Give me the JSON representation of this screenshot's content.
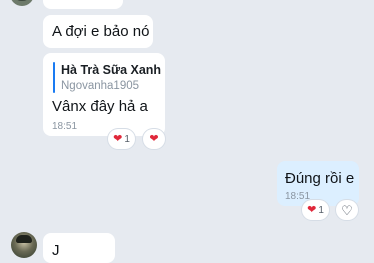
{
  "conversation": {
    "messages": [
      {
        "id": "m2",
        "text": "A đợi e bảo nó"
      },
      {
        "id": "m3",
        "quote": {
          "author": "Hà Trà Sữa Xanh",
          "text": "Ngovanha1905"
        },
        "text": "Vânx đây hả a",
        "time": "18:51",
        "reactions": {
          "heart_count": "1"
        }
      },
      {
        "id": "m4",
        "text": "Đúng rồi e",
        "time": "18:51",
        "reactions": {
          "heart_count": "1"
        }
      },
      {
        "id": "m5",
        "text": "J"
      }
    ]
  },
  "colors": {
    "background": "#e6eaf0",
    "incoming_bubble": "#ffffff",
    "outgoing_bubble": "#dcefff",
    "quote_bar": "#1a7bf2",
    "heart": "#e0283a",
    "timestamp": "#8a95a1"
  },
  "icons": {
    "reaction_filled": "heart-icon",
    "reaction_add": "heart-outline-icon"
  }
}
